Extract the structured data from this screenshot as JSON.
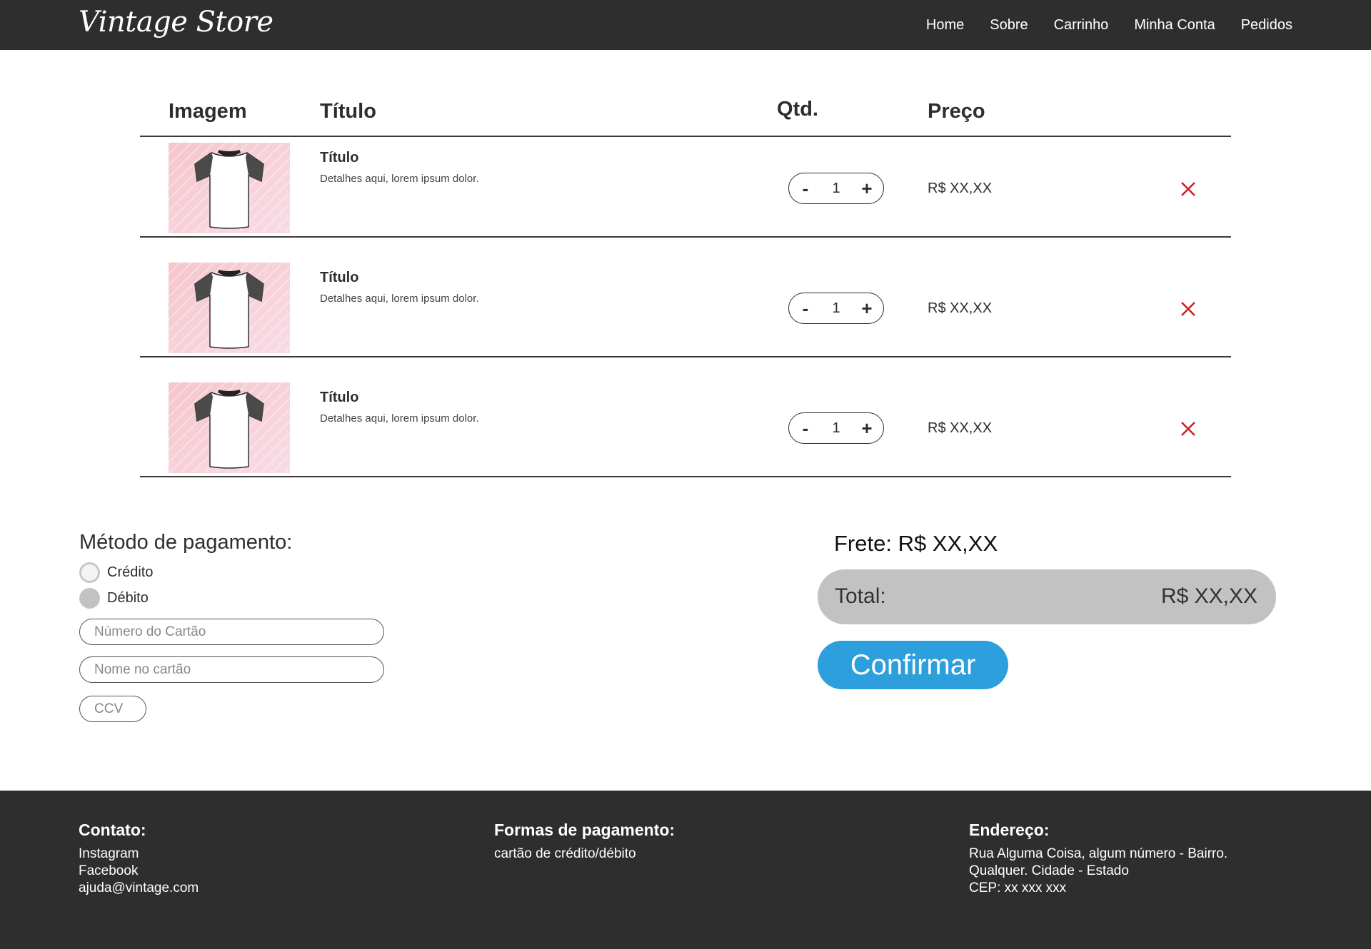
{
  "header": {
    "logo": "Vintage Store",
    "nav": [
      "Home",
      "Sobre",
      "Carrinho",
      "Minha Conta",
      "Pedidos"
    ]
  },
  "table": {
    "headers": {
      "image": "Imagem",
      "title": "Título",
      "qty": "Qtd.",
      "price": "Preço"
    },
    "items": [
      {
        "title": "Título",
        "description": "Detalhes aqui, lorem ipsum dolor.",
        "qty": "1",
        "price": "R$ XX,XX",
        "minus": "-",
        "plus": "+"
      },
      {
        "title": "Título",
        "description": "Detalhes aqui, lorem ipsum dolor.",
        "qty": "1",
        "price": "R$ XX,XX",
        "minus": "-",
        "plus": "+"
      },
      {
        "title": "Título",
        "description": "Detalhes aqui, lorem ipsum dolor.",
        "qty": "1",
        "price": "R$ XX,XX",
        "minus": "-",
        "plus": "+"
      }
    ]
  },
  "payment": {
    "title": "Método de pagamento:",
    "options": [
      "Crédito",
      "Débito"
    ],
    "card_number_placeholder": "Número do Cartão",
    "card_name_placeholder": "Nome no cartão",
    "ccv_placeholder": "CCV"
  },
  "summary": {
    "frete": "Frete: R$ XX,XX",
    "total_label": "Total:",
    "total_value": "R$ XX,XX",
    "confirm_label": "Confirmar"
  },
  "footer": {
    "contact_title": "Contato:",
    "contact_lines": [
      "Instagram",
      "Facebook",
      "ajuda@vintage.com"
    ],
    "payment_title": "Formas de pagamento:",
    "payment_lines": [
      "cartão de crédito/débito"
    ],
    "address_title": "Endereço:",
    "address_lines": [
      "Rua Alguma Coisa, algum número - Bairro.",
      "Qualquer. Cidade - Estado",
      "CEP: xx xxx xxx"
    ]
  },
  "colors": {
    "header_bg": "#2e2e2e",
    "confirm_blue": "#2d9fdd",
    "remove_red": "#cc1f1f",
    "total_bg": "#c2c2c2"
  },
  "icons": [
    "remove-x-icon",
    "tshirt-thumbnail"
  ]
}
